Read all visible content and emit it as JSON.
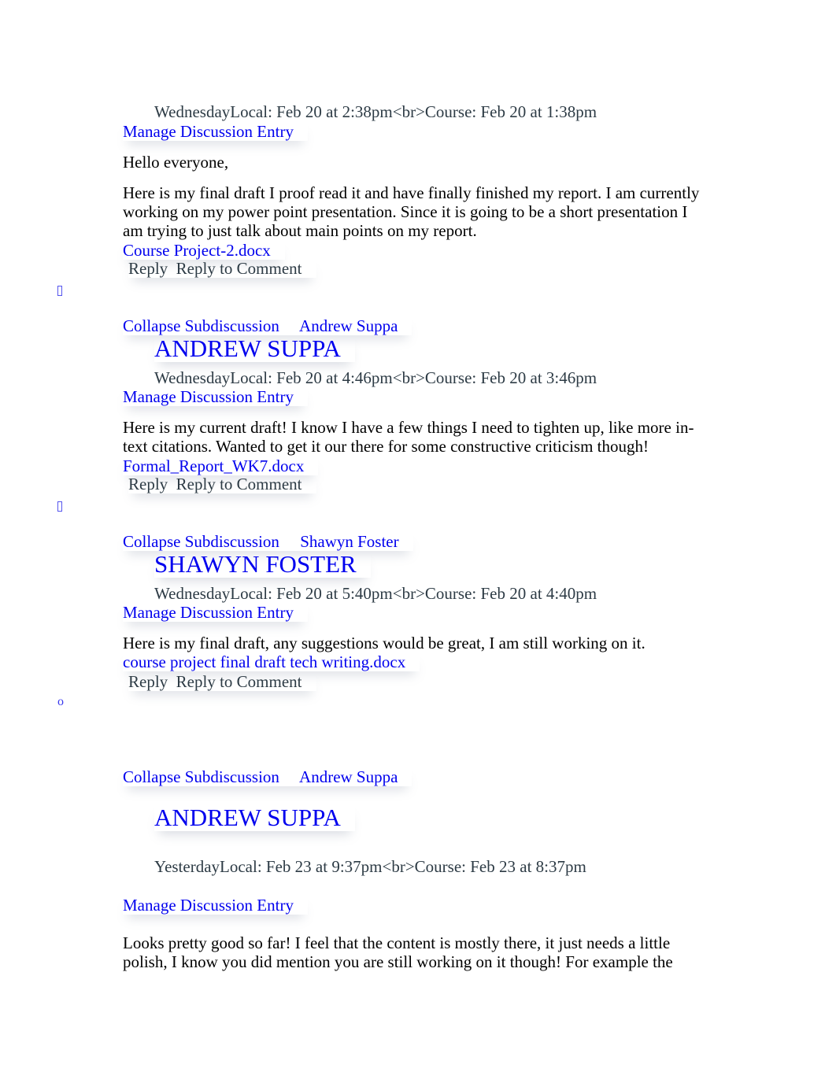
{
  "entries": [
    {
      "meta": "WednesdayLocal: Feb 20 at 2:38pm<br>Course: Feb 20 at 1:38pm",
      "manage": "Manage Discussion Entry",
      "paragraphs": [
        "Hello everyone,",
        "Here is my final draft I proof read it and have finally finished my report. I am currently working on my power point presentation. Since it is going to be a short presentation I am trying to just talk about main points on my report."
      ],
      "attachment": "Course Project-2.docx",
      "reply": "Reply",
      "reply_comment": "Reply to Comment"
    },
    {
      "collapse": "Collapse Subdiscussion",
      "author_link": "Andrew Suppa",
      "author_heading": "ANDREW SUPPA",
      "meta": "WednesdayLocal: Feb 20 at 4:46pm<br>Course: Feb 20 at 3:46pm",
      "manage": "Manage Discussion Entry",
      "paragraphs": [
        "Here is my current draft! I know I have a few things I need to tighten up, like more in-text citations. Wanted to get it our there for some constructive criticism though!"
      ],
      "attachment": "Formal_Report_WK7.docx",
      "reply": "Reply",
      "reply_comment": "Reply to Comment"
    },
    {
      "collapse": "Collapse Subdiscussion",
      "author_link": "Shawyn Foster",
      "author_heading": "SHAWYN FOSTER",
      "meta": "WednesdayLocal: Feb 20 at 5:40pm<br>Course: Feb 20 at 4:40pm",
      "manage": "Manage Discussion Entry",
      "paragraphs": [
        "Here is my final draft, any suggestions would be great, I am still working on it."
      ],
      "attachment": "course project final draft tech writing.docx",
      "reply": "Reply",
      "reply_comment": "Reply to Comment"
    },
    {
      "collapse": "Collapse Subdiscussion",
      "author_link": "Andrew Suppa",
      "author_heading": "ANDREW SUPPA",
      "meta": "YesterdayLocal: Feb 23 at 9:37pm<br>Course: Feb 23 at 8:37pm",
      "manage": "Manage Discussion Entry",
      "paragraphs": [
        "Looks pretty good so far! I feel that the content is mostly there, it just needs a little polish, I know you did mention you are still working on it though! For example the"
      ]
    }
  ],
  "bullets": {
    "square_icon": "square-bullet-icon",
    "circle_label": "o"
  }
}
